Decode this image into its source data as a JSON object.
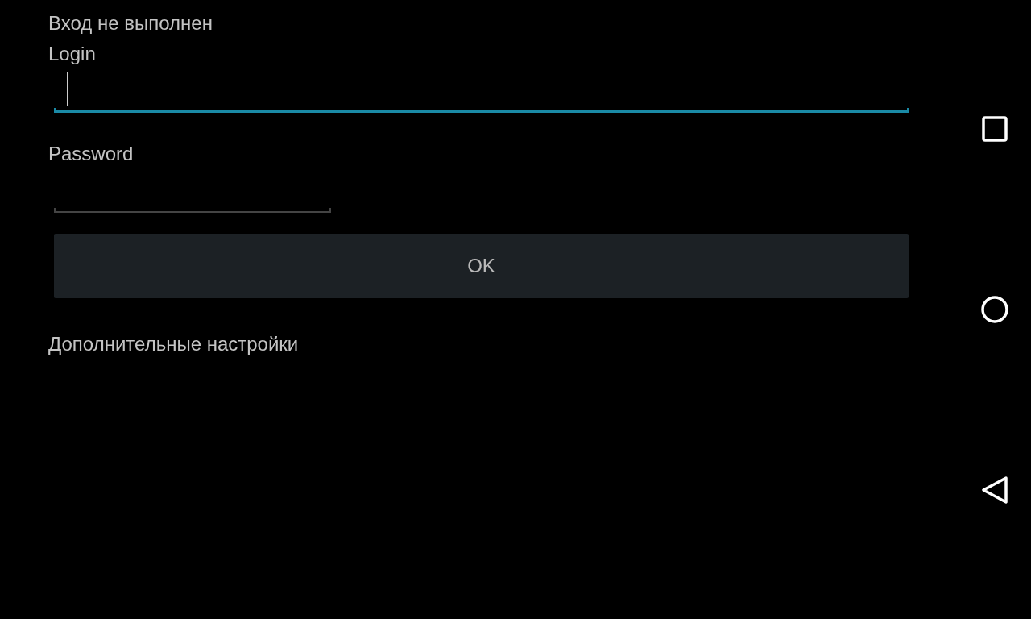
{
  "status": {
    "text": "Вход не выполнен"
  },
  "fields": [
    {
      "label": "Login",
      "focused": true,
      "kind": "text"
    },
    {
      "label": "Password",
      "focused": false,
      "kind": "password"
    }
  ],
  "button": {
    "label": "OK"
  },
  "link": {
    "text": "Дополнительные настройки"
  },
  "nav_bar": {
    "buttons": [
      {
        "kind": "recents"
      },
      {
        "kind": "home"
      },
      {
        "kind": "back"
      }
    ]
  }
}
